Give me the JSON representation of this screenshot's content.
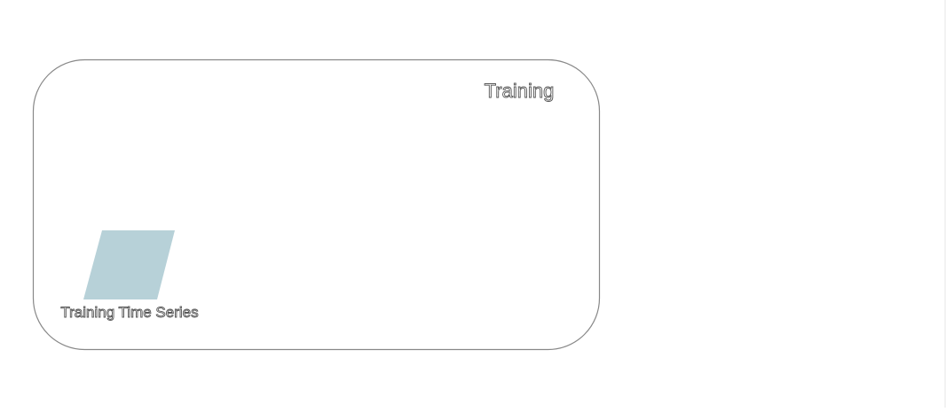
{
  "diagram": {
    "group": {
      "title": "Training"
    },
    "nodes": [
      {
        "label": "Training Time Series",
        "shape": "parallelogram",
        "fill": "#b7d1d8"
      }
    ],
    "colors": {
      "container_border": "#888888",
      "node_fill": "#b7d1d8",
      "text_outline": "#555555"
    }
  }
}
